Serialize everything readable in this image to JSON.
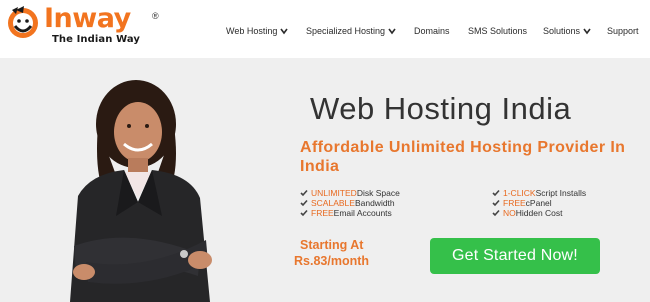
{
  "brand": {
    "name": "Inway",
    "registered": "®",
    "tagline": "The Indian Way",
    "color": "#f2741f"
  },
  "nav": {
    "items": [
      {
        "label": "Web Hosting",
        "dropdown": true
      },
      {
        "label": "Specialized Hosting",
        "dropdown": true
      },
      {
        "label": "Domains",
        "dropdown": false
      },
      {
        "label": "SMS Solutions",
        "dropdown": false
      },
      {
        "label": "Solutions",
        "dropdown": true
      },
      {
        "label": "Support",
        "dropdown": false
      }
    ]
  },
  "hero": {
    "title": "Web Hosting India",
    "subtitle": "Affordable Unlimited Hosting Provider In India",
    "features_left": [
      {
        "highlight": "UNLIMITED",
        "text": " Disk Space"
      },
      {
        "highlight": "SCALABLE",
        "text": " Bandwidth"
      },
      {
        "highlight": "FREE",
        "text": " Email Accounts"
      }
    ],
    "features_right": [
      {
        "highlight": "1-CLICK",
        "text": " Script Installs"
      },
      {
        "highlight": "FREE",
        "text": " cPanel"
      },
      {
        "highlight": "NO",
        "text": " Hidden Cost"
      }
    ],
    "starting_label": "Starting At",
    "price_prefix": "Rs.",
    "price_amount": "83",
    "price_suffix": "/month",
    "cta_label": "Get Started Now!",
    "accent_color": "#e8772e",
    "cta_color": "#35c04a"
  }
}
